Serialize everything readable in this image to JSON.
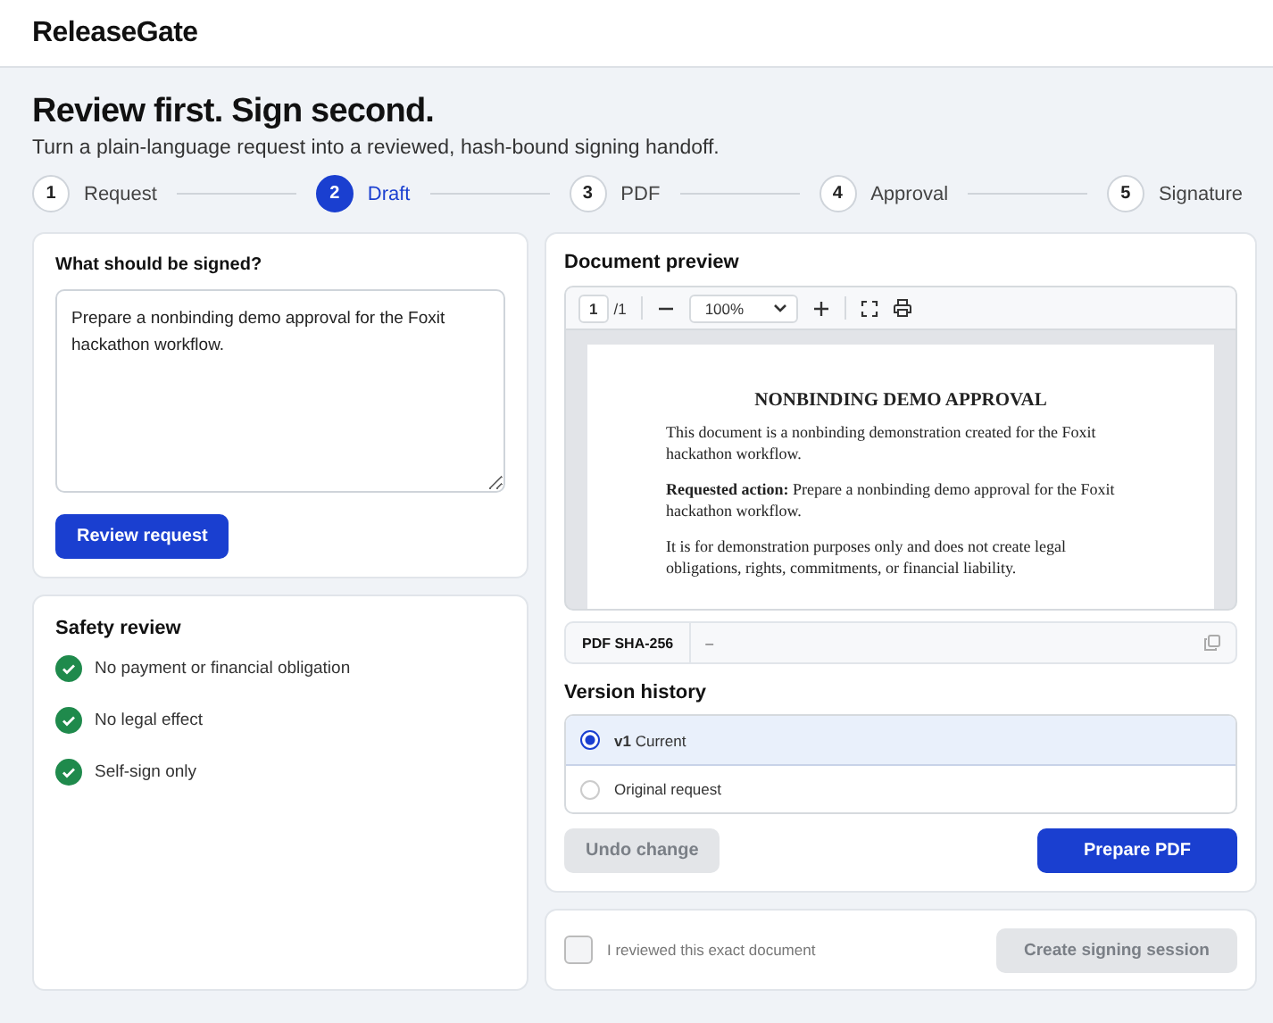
{
  "app": {
    "name": "ReleaseGate"
  },
  "hero": {
    "title": "Review first. Sign second.",
    "subtitle": "Turn a plain-language request into a reviewed, hash-bound signing handoff."
  },
  "steps": [
    {
      "number": "1",
      "label": "Request",
      "selected": false
    },
    {
      "number": "2",
      "label": "Draft",
      "selected": true
    },
    {
      "number": "3",
      "label": "PDF",
      "selected": false
    },
    {
      "number": "4",
      "label": "Approval",
      "selected": false
    },
    {
      "number": "5",
      "label": "Signature",
      "selected": false
    }
  ],
  "request": {
    "label": "What should be signed?",
    "value": "Prepare a nonbinding demo approval for the Foxit hackathon workflow.",
    "button": "Review request"
  },
  "safety": {
    "title": "Safety review",
    "items": [
      {
        "label": "No payment or financial obligation",
        "checked": true
      },
      {
        "label": "No legal effect",
        "checked": true
      },
      {
        "label": "Self-sign only",
        "checked": true
      }
    ]
  },
  "preview": {
    "title": "Document preview",
    "page": "1",
    "page_count": "/1",
    "zoom": "100%",
    "document": {
      "heading": "NONBINDING DEMO APPROVAL",
      "paragraphs": [
        "This document is a nonbinding demonstration created for the Foxit hackathon workflow.",
        "**Requested action:** Prepare a nonbinding demo approval for the Foxit hackathon workflow.",
        "It is for demonstration purposes only and does not create legal obligations, rights, commitments, or financial liability."
      ]
    },
    "hash_label": "PDF SHA-256",
    "hash_value": "–"
  },
  "versions": {
    "title": "Version history",
    "items": [
      {
        "tag": "v1",
        "label": "Current",
        "selected": true
      },
      {
        "label": "Original request",
        "selected": false
      }
    ]
  },
  "actions": [
    {
      "label": "Undo change",
      "disabled": true
    },
    {
      "label": "Prepare PDF",
      "disabled": false
    }
  ],
  "confirm": {
    "label": "I reviewed this exact document",
    "checked": false,
    "button": "Create signing session",
    "disabled": true
  }
}
